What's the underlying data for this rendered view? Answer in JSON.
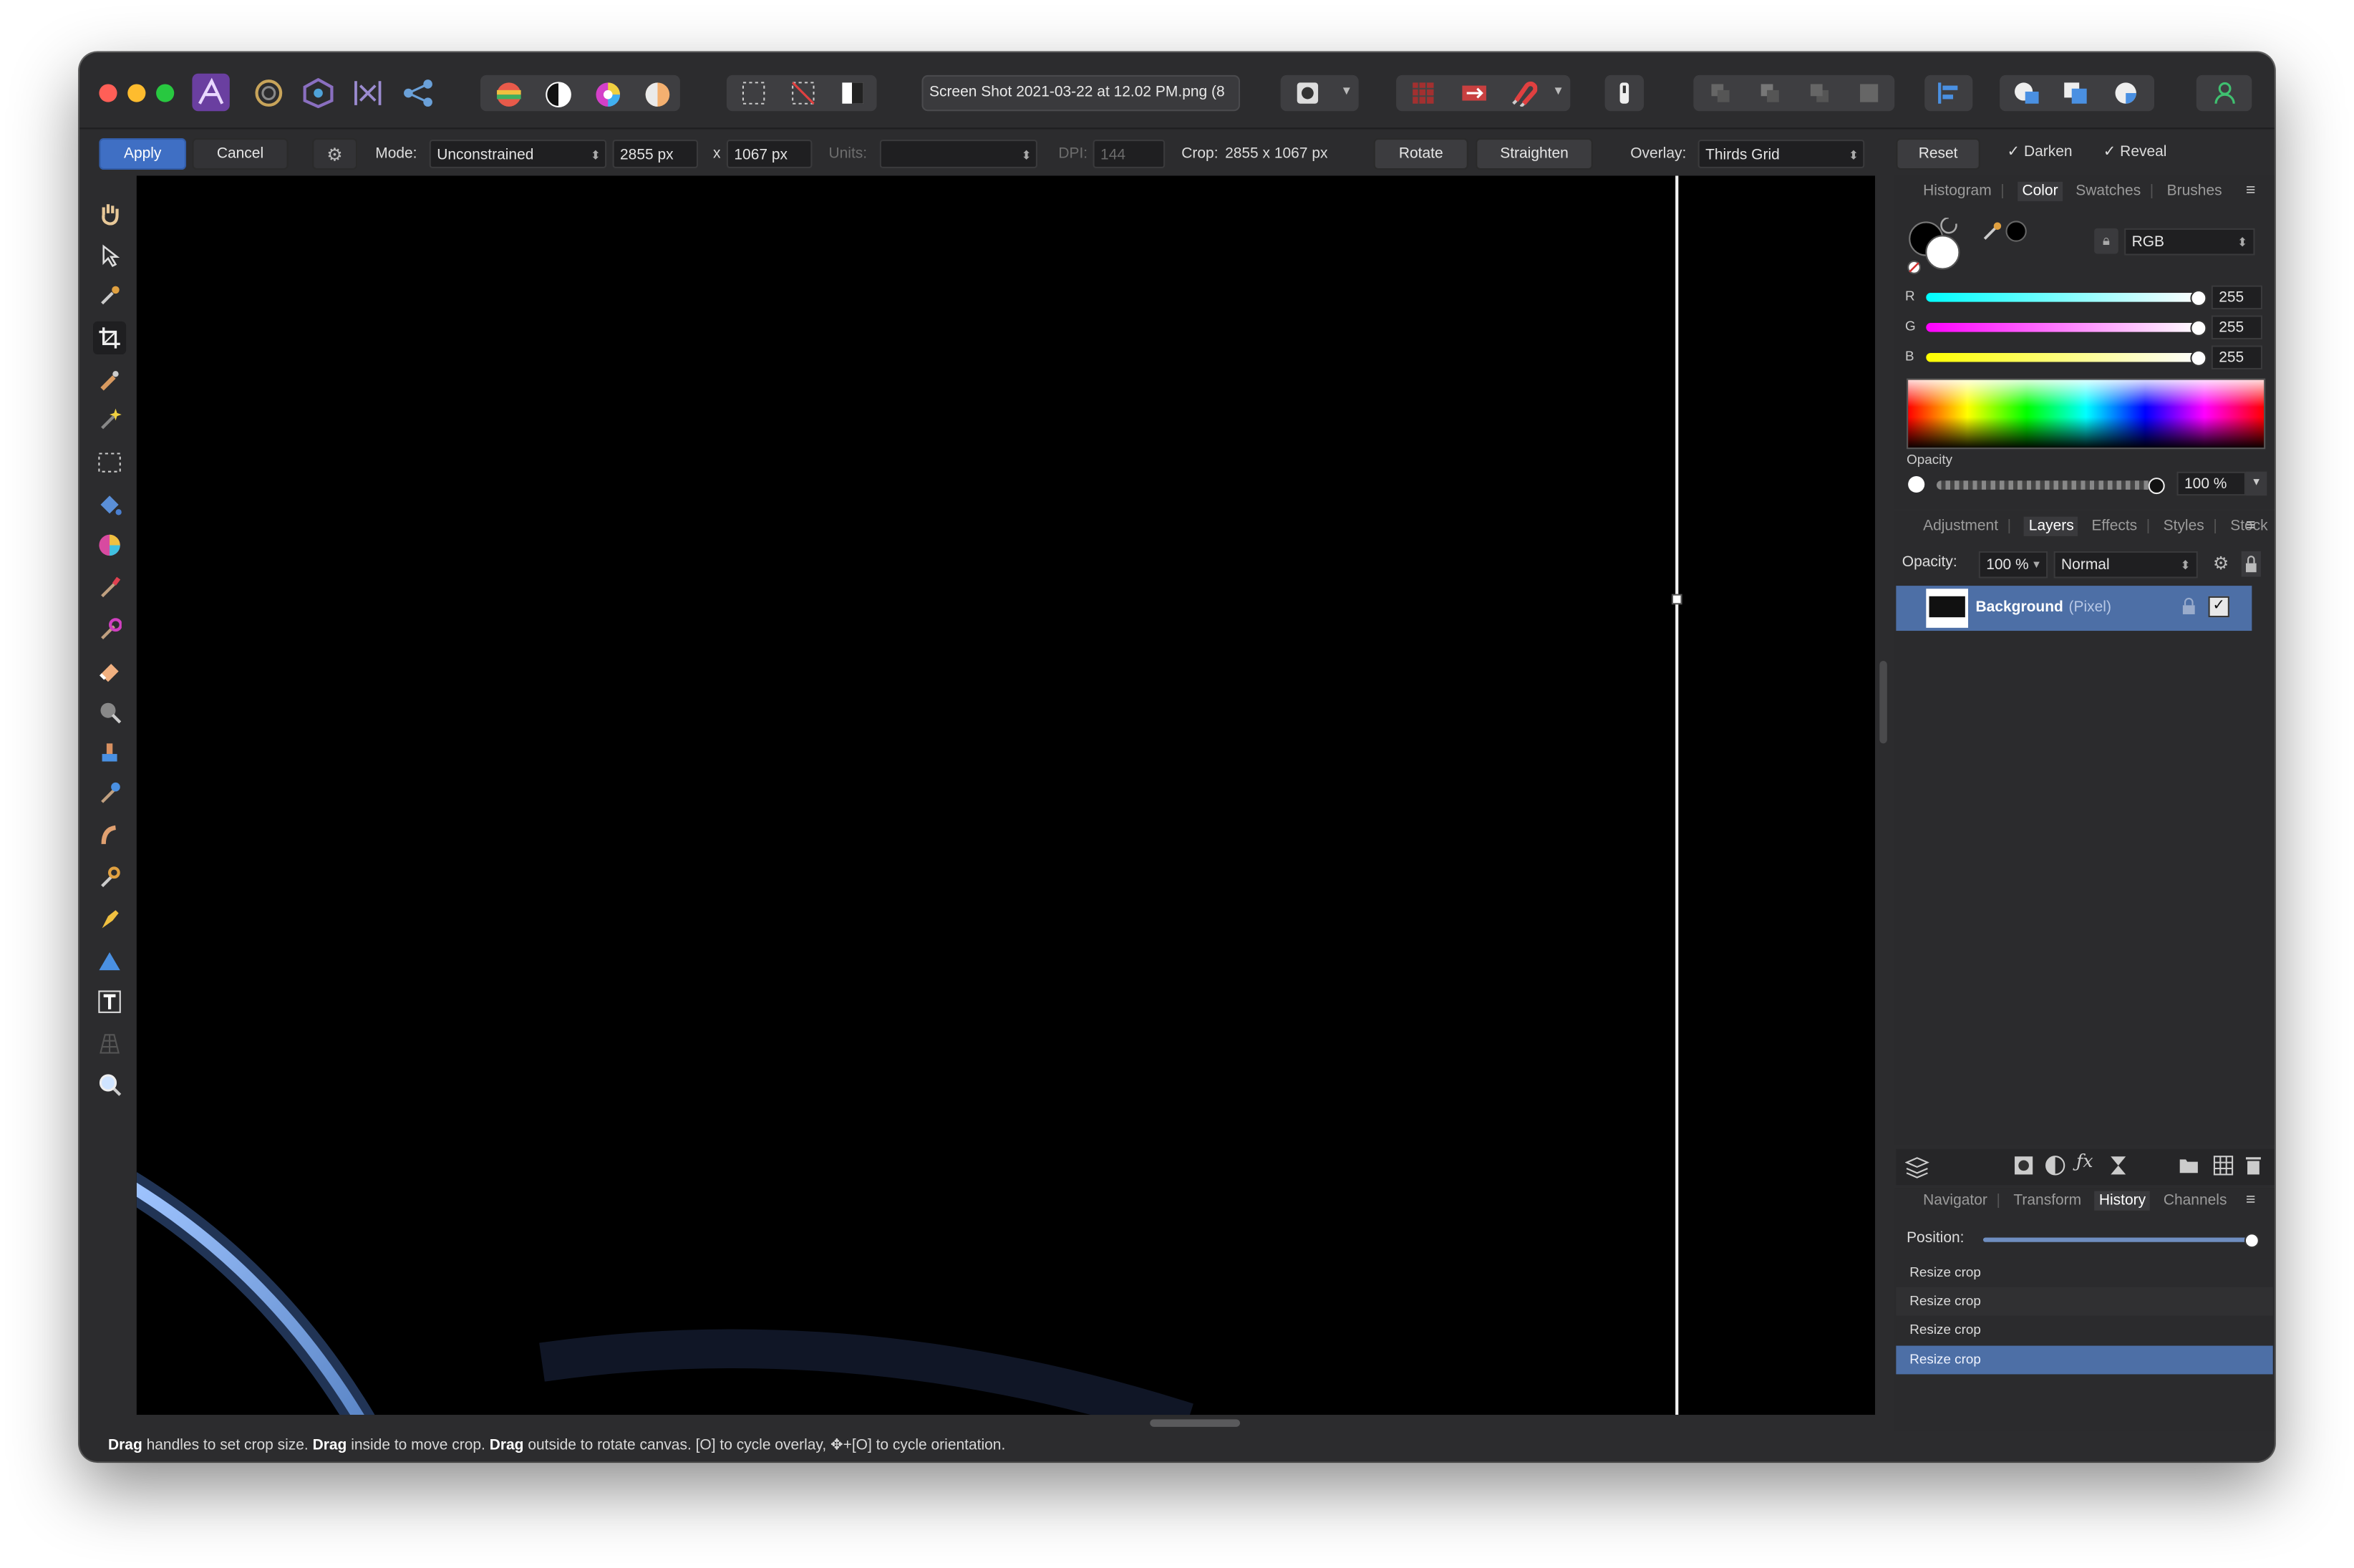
{
  "document": {
    "title": "Screen Shot 2021-03-22 at 12.02 PM.png (8"
  },
  "context_toolbar": {
    "apply": "Apply",
    "cancel": "Cancel",
    "mode_label": "Mode:",
    "mode_value": "Unconstrained",
    "width_value": "2855 px",
    "times": "x",
    "height_value": "1067 px",
    "units_label": "Units:",
    "units_value": "",
    "dpi_label": "DPI:",
    "dpi_value": "144",
    "crop_label": "Crop:",
    "crop_value": "2855 x 1067 px",
    "rotate": "Rotate",
    "straighten": "Straighten",
    "overlay_label": "Overlay:",
    "overlay_value": "Thirds Grid",
    "reset": "Reset",
    "darken": "Darken",
    "reveal": "Reveal"
  },
  "color_panel": {
    "tabs": [
      "Histogram",
      "Color",
      "Swatches",
      "Brushes"
    ],
    "model": "RGB",
    "r_label": "R",
    "r_value": "255",
    "g_label": "G",
    "g_value": "255",
    "b_label": "B",
    "b_value": "255",
    "opacity_label": "Opacity",
    "opacity_value": "100 %",
    "fill_color": "#000000",
    "stroke_color": "#ffffff"
  },
  "layers_panel": {
    "tabs": [
      "Adjustment",
      "Layers",
      "Effects",
      "Styles",
      "Stock"
    ],
    "opacity_label": "Opacity:",
    "opacity_value": "100 %",
    "blend_mode": "Normal",
    "layer_name": "Background",
    "layer_type": "(Pixel)"
  },
  "history_panel": {
    "tabs": [
      "Navigator",
      "Transform",
      "History",
      "Channels"
    ],
    "position_label": "Position:",
    "items": [
      "Resize crop",
      "Resize crop",
      "Resize crop",
      "Resize crop"
    ]
  },
  "status_bar": {
    "drag1": "Drag",
    "text1": " handles to set crop size. ",
    "drag2": "Drag",
    "text2": " inside to move crop. ",
    "drag3": "Drag",
    "text3": " outside to rotate canvas. [O] to cycle overlay, ✥+[O] to cycle orientation."
  },
  "colors": {
    "accent": "#3f6fc4",
    "window_bg": "#2c2c2e",
    "panel_bg": "#2b2b2d",
    "selection": "#4d6fa6"
  }
}
